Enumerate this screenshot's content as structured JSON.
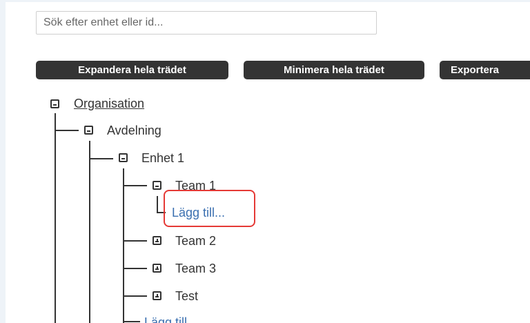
{
  "search": {
    "placeholder": "Sök efter enhet eller id...",
    "value": ""
  },
  "toolbar": {
    "expand_label": "Expandera hela trädet",
    "collapse_label": "Minimera hela trädet",
    "export_label": "Exportera"
  },
  "tree": {
    "root": {
      "label": "Organisation",
      "state": "expanded"
    },
    "department": {
      "label": "Avdelning",
      "state": "expanded"
    },
    "unit": {
      "label": "Enhet 1",
      "state": "expanded"
    },
    "team1": {
      "label": "Team 1",
      "state": "expanded",
      "add_label": "Lägg till..."
    },
    "team2": {
      "label": "Team 2",
      "state": "collapsed"
    },
    "team3": {
      "label": "Team 3",
      "state": "collapsed"
    },
    "test": {
      "label": "Test",
      "state": "collapsed"
    },
    "unit_add_label": "Lägg till..."
  },
  "colors": {
    "button_bg": "#343434",
    "link": "#3a6fb0",
    "highlight": "#e53935"
  }
}
